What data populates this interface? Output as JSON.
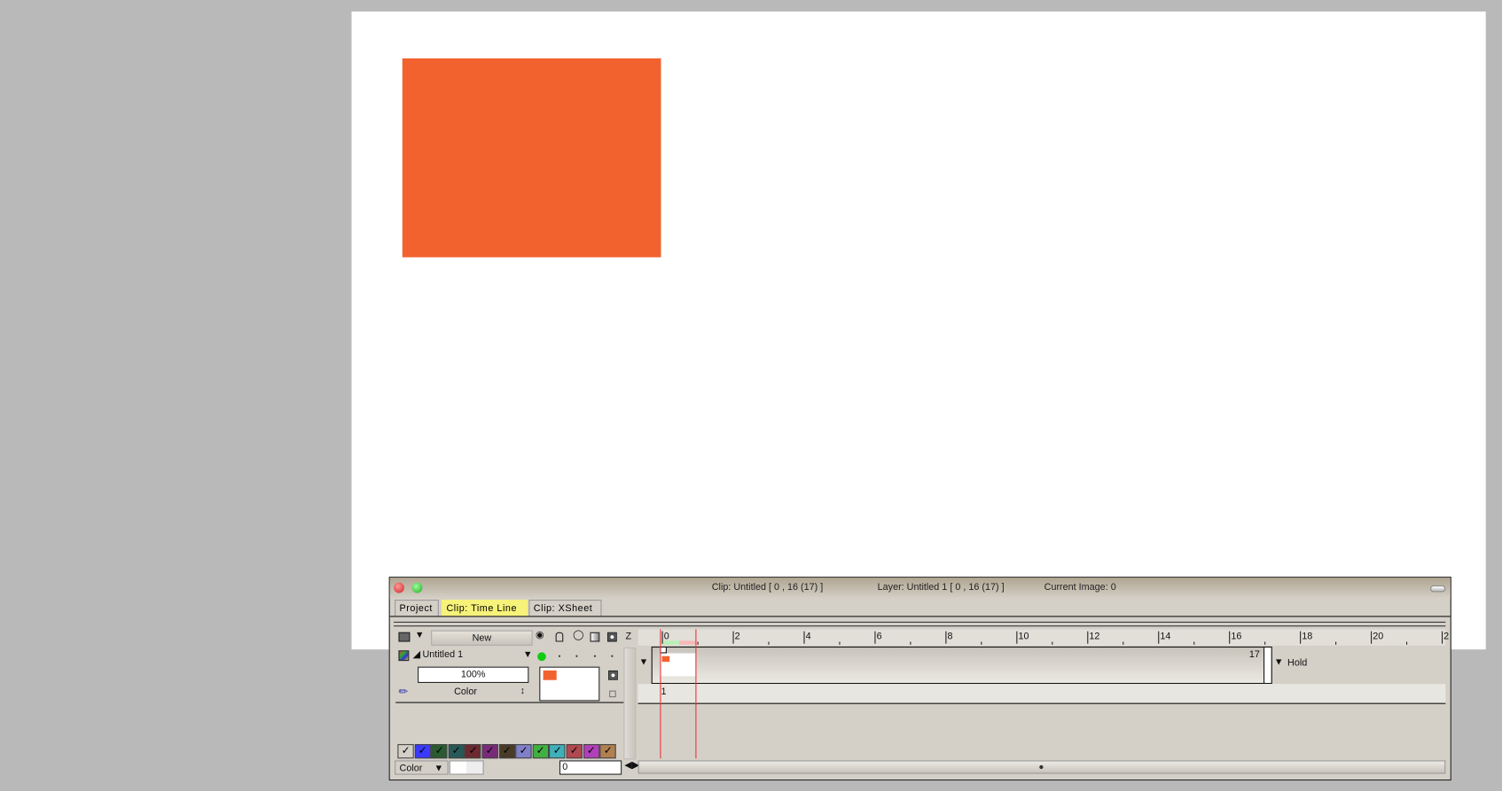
{
  "canvas": {
    "shape_color": "#f2622e",
    "background": "#ffffff"
  },
  "window": {
    "title": {
      "clip": "Clip: Untitled [ 0 , 16  (17) ]",
      "layer": "Layer: Untitled 1 [ 0 , 16  (17) ]",
      "current": "Current Image: 0"
    },
    "tabs": [
      {
        "label": "Project",
        "active": false
      },
      {
        "label": "Clip: Time Line",
        "active": true
      },
      {
        "label": "Clip: XSheet",
        "active": false
      }
    ],
    "toolbar": {
      "new_label": "New",
      "z_label": "Z"
    },
    "layer": {
      "name": "Untitled 1",
      "opacity": "100%",
      "mode": "Color",
      "visible": true
    },
    "palette": [
      "#d4d0c8",
      "#3a3aff",
      "#2a5a30",
      "#285858",
      "#6a2a30",
      "#7a2a7a",
      "#4a3a28",
      "#8080c8",
      "#40b040",
      "#40b0b8",
      "#b04850",
      "#b040b8",
      "#b08050"
    ],
    "bottom": {
      "color_mode": "Color",
      "frame_input": "0"
    },
    "timeline": {
      "ruler_labels": [
        "0",
        "2",
        "4",
        "6",
        "8",
        "10",
        "12",
        "14",
        "16",
        "18",
        "20",
        "2"
      ],
      "clip_end_label": "17",
      "hold_label": "Hold",
      "frame_number": "1",
      "current_frame": 0
    }
  }
}
